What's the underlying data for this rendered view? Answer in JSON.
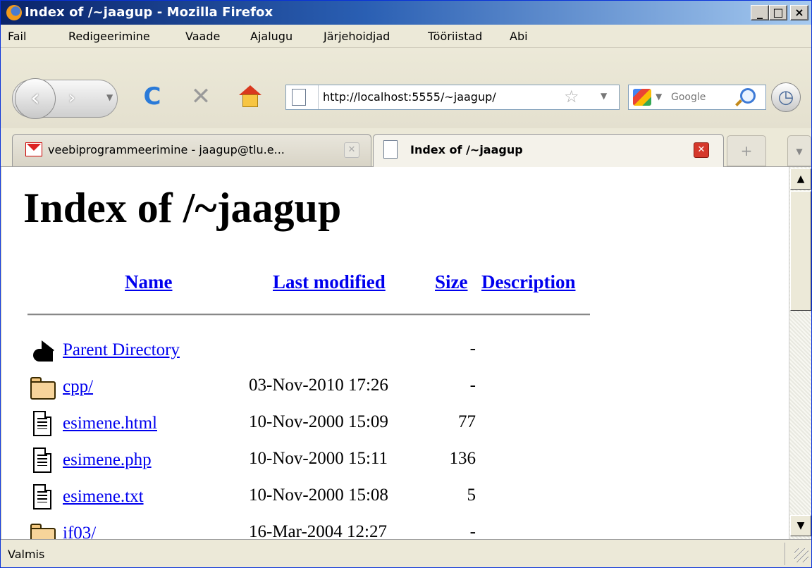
{
  "window": {
    "title": "Index of /~jaagup - Mozilla Firefox",
    "controls": {
      "minimize": "_",
      "maximize": "□",
      "close": "×"
    }
  },
  "menubar": {
    "items": [
      "Fail",
      "Redigeerimine",
      "Vaade",
      "Ajalugu",
      "Järjehoidjad",
      "Tööriistad",
      "Abi"
    ]
  },
  "toolbar": {
    "back_glyph": "‹",
    "forward_glyph": "›",
    "reload_glyph": "C",
    "stop_glyph": "✕",
    "url": "http://localhost:5555/~jaagup/",
    "search_placeholder": "Google",
    "icons": [
      "back-icon",
      "forward-icon",
      "reload-icon",
      "stop-icon",
      "home-icon",
      "page-icon",
      "star-icon",
      "google-icon",
      "search-icon",
      "history-icon"
    ]
  },
  "tabs": [
    {
      "label": "veebiprogrammeerimine - jaagup@tlu.e...",
      "active": false,
      "icon": "gmail-icon"
    },
    {
      "label": "Index of /~jaagup",
      "active": true,
      "icon": "page-icon"
    }
  ],
  "newtab_glyph": "+",
  "page": {
    "heading": "Index of /~jaagup",
    "columns": {
      "name": "Name",
      "modified": "Last modified",
      "size": "Size",
      "description": "Description"
    },
    "rows": [
      {
        "icon": "back-icon",
        "name": "Parent Directory",
        "modified": "",
        "size": "-"
      },
      {
        "icon": "folder-icon",
        "name": "cpp/",
        "modified": "03-Nov-2010 17:26",
        "size": "-"
      },
      {
        "icon": "document-icon",
        "name": "esimene.html",
        "modified": "10-Nov-2000 15:09",
        "size": "77"
      },
      {
        "icon": "document-icon",
        "name": "esimene.php",
        "modified": "10-Nov-2000 15:11",
        "size": "136"
      },
      {
        "icon": "document-icon",
        "name": "esimene.txt",
        "modified": "10-Nov-2000 15:08",
        "size": "5"
      },
      {
        "icon": "folder-icon",
        "name": "if03/",
        "modified": "16-Mar-2004 12:27",
        "size": "-"
      }
    ]
  },
  "statusbar": {
    "text": "Valmis"
  }
}
